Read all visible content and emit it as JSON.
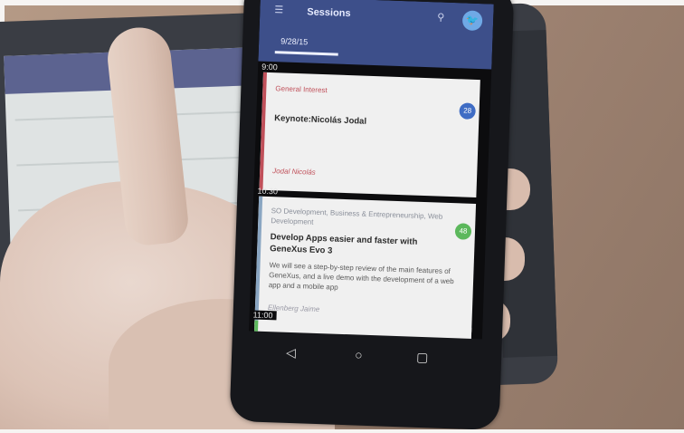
{
  "app": {
    "title": "Sessions",
    "tabs": [
      {
        "label": "9/28/15",
        "active": true
      },
      {
        "label": "",
        "active": false
      },
      {
        "label": "",
        "active": false
      }
    ],
    "accent_color": "#3d4f8a"
  },
  "schedule": [
    {
      "time": "9:00",
      "session": {
        "category": "General Interest",
        "title": "Keynote:Nicolás Jodal",
        "speaker": "Jodal Nicolás",
        "badge": "28",
        "category_color": "#c0505a",
        "badge_color": "#3f6cc4"
      }
    },
    {
      "time": "10:30",
      "session": {
        "category": "SO Development, Business & Entrepreneurship, Web Development",
        "title": "Develop Apps easier and faster with GeneXus Evo 3",
        "description": "We will see a step-by-step review of the main features of GeneXus, and a live demo with the development of a web app and a mobile app",
        "speaker": "Ellenberg Jaime",
        "badge": "48",
        "category_color": "#8a8f9a",
        "badge_color": "#5cb85c"
      }
    },
    {
      "time": "11:00"
    }
  ],
  "icons": {
    "menu": "menu-icon",
    "search": "search-icon",
    "twitter": "twitter-icon",
    "back": "back-icon",
    "home": "home-icon",
    "recents": "recents-icon"
  }
}
